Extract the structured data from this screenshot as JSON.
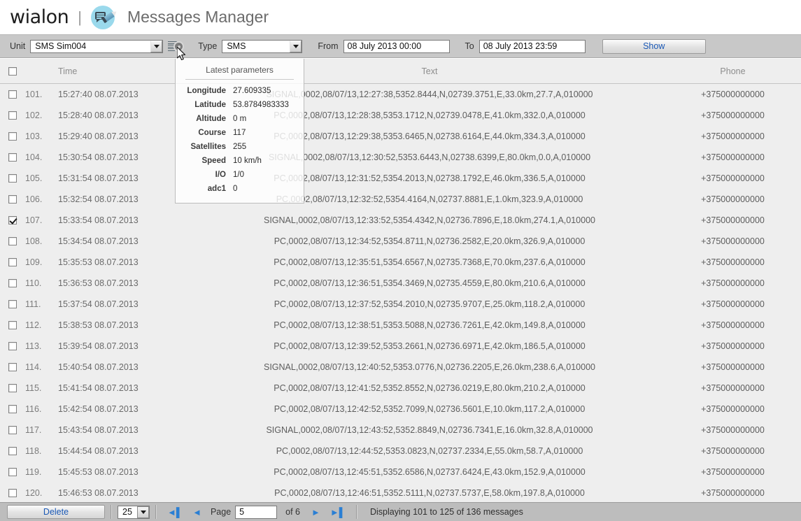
{
  "header": {
    "brand": "wialon",
    "separator": "|",
    "app_icon": "messages-pencil-icon",
    "title": "Messages Manager"
  },
  "toolbar": {
    "unit_label": "Unit",
    "unit_value": "SMS Sim004",
    "settings_icon": "list-gear-icon",
    "type_label": "Type",
    "type_value": "SMS",
    "from_label": "From",
    "from_value": "08 July 2013 00:00",
    "to_label": "To",
    "to_value": "08 July 2013 23:59",
    "show_label": "Show"
  },
  "params_popup": {
    "title": "Latest parameters",
    "rows": [
      {
        "key": "Longitude",
        "value": "27.609335"
      },
      {
        "key": "Latitude",
        "value": "53.8784983333"
      },
      {
        "key": "Altitude",
        "value": "0 m"
      },
      {
        "key": "Course",
        "value": "117"
      },
      {
        "key": "Satellites",
        "value": "255"
      },
      {
        "key": "Speed",
        "value": "10 km/h"
      },
      {
        "key": "I/O",
        "value": "1/0"
      },
      {
        "key": "adc1",
        "value": "0"
      }
    ]
  },
  "table": {
    "columns": [
      "",
      "",
      "Time",
      "Text",
      "Phone"
    ],
    "header": {
      "time": "Time",
      "text": "Text",
      "phone": "Phone"
    },
    "rows": [
      {
        "checked": false,
        "num": "101.",
        "time": "15:27:40  08.07.2013",
        "text": "SIGNAL,0002,08/07/13,12:27:38,5352.8444,N,02739.3751,E,33.0km,27.7,A,010000",
        "phone": "+375000000000"
      },
      {
        "checked": false,
        "num": "102.",
        "time": "15:28:40  08.07.2013",
        "text": "PC,0002,08/07/13,12:28:38,5353.1712,N,02739.0478,E,41.0km,332.0,A,010000",
        "phone": "+375000000000"
      },
      {
        "checked": false,
        "num": "103.",
        "time": "15:29:40  08.07.2013",
        "text": "PC,0002,08/07/13,12:29:38,5353.6465,N,02738.6164,E,44.0km,334.3,A,010000",
        "phone": "+375000000000"
      },
      {
        "checked": false,
        "num": "104.",
        "time": "15:30:54  08.07.2013",
        "text": "SIGNAL,0002,08/07/13,12:30:52,5353.6443,N,02738.6399,E,80.0km,0.0,A,010000",
        "phone": "+375000000000"
      },
      {
        "checked": false,
        "num": "105.",
        "time": "15:31:54  08.07.2013",
        "text": "PC,0002,08/07/13,12:31:52,5354.2013,N,02738.1792,E,46.0km,336.5,A,010000",
        "phone": "+375000000000"
      },
      {
        "checked": false,
        "num": "106.",
        "time": "15:32:54  08.07.2013",
        "text": "PC,0002,08/07/13,12:32:52,5354.4164,N,02737.8881,E,1.0km,323.9,A,010000",
        "phone": "+375000000000"
      },
      {
        "checked": true,
        "num": "107.",
        "time": "15:33:54  08.07.2013",
        "text": "SIGNAL,0002,08/07/13,12:33:52,5354.4342,N,02736.7896,E,18.0km,274.1,A,010000",
        "phone": "+375000000000"
      },
      {
        "checked": false,
        "num": "108.",
        "time": "15:34:54  08.07.2013",
        "text": "PC,0002,08/07/13,12:34:52,5354.8711,N,02736.2582,E,20.0km,326.9,A,010000",
        "phone": "+375000000000"
      },
      {
        "checked": false,
        "num": "109.",
        "time": "15:35:53  08.07.2013",
        "text": "PC,0002,08/07/13,12:35:51,5354.6567,N,02735.7368,E,70.0km,237.6,A,010000",
        "phone": "+375000000000"
      },
      {
        "checked": false,
        "num": "110.",
        "time": "15:36:53  08.07.2013",
        "text": "PC,0002,08/07/13,12:36:51,5354.3469,N,02735.4559,E,80.0km,210.6,A,010000",
        "phone": "+375000000000"
      },
      {
        "checked": false,
        "num": "111.",
        "time": "15:37:54  08.07.2013",
        "text": "PC,0002,08/07/13,12:37:52,5354.2010,N,02735.9707,E,25.0km,118.2,A,010000",
        "phone": "+375000000000"
      },
      {
        "checked": false,
        "num": "112.",
        "time": "15:38:53  08.07.2013",
        "text": "PC,0002,08/07/13,12:38:51,5353.5088,N,02736.7261,E,42.0km,149.8,A,010000",
        "phone": "+375000000000"
      },
      {
        "checked": false,
        "num": "113.",
        "time": "15:39:54  08.07.2013",
        "text": "PC,0002,08/07/13,12:39:52,5353.2661,N,02736.6971,E,42.0km,186.5,A,010000",
        "phone": "+375000000000"
      },
      {
        "checked": false,
        "num": "114.",
        "time": "15:40:54  08.07.2013",
        "text": "SIGNAL,0002,08/07/13,12:40:52,5353.0776,N,02736.2205,E,26.0km,238.6,A,010000",
        "phone": "+375000000000"
      },
      {
        "checked": false,
        "num": "115.",
        "time": "15:41:54  08.07.2013",
        "text": "PC,0002,08/07/13,12:41:52,5352.8552,N,02736.0219,E,80.0km,210.2,A,010000",
        "phone": "+375000000000"
      },
      {
        "checked": false,
        "num": "116.",
        "time": "15:42:54  08.07.2013",
        "text": "PC,0002,08/07/13,12:42:52,5352.7099,N,02736.5601,E,10.0km,117.2,A,010000",
        "phone": "+375000000000"
      },
      {
        "checked": false,
        "num": "117.",
        "time": "15:43:54  08.07.2013",
        "text": "SIGNAL,0002,08/07/13,12:43:52,5352.8849,N,02736.7341,E,16.0km,32.8,A,010000",
        "phone": "+375000000000"
      },
      {
        "checked": false,
        "num": "118.",
        "time": "15:44:54  08.07.2013",
        "text": "PC,0002,08/07/13,12:44:52,5353.0823,N,02737.2334,E,55.0km,58.7,A,010000",
        "phone": "+375000000000"
      },
      {
        "checked": false,
        "num": "119.",
        "time": "15:45:53  08.07.2013",
        "text": "PC,0002,08/07/13,12:45:51,5352.6586,N,02737.6424,E,43.0km,152.9,A,010000",
        "phone": "+375000000000"
      },
      {
        "checked": false,
        "num": "120.",
        "time": "15:46:53  08.07.2013",
        "text": "PC,0002,08/07/13,12:46:51,5352.5111,N,02737.5737,E,58.0km,197.8,A,010000",
        "phone": "+375000000000"
      }
    ]
  },
  "footer": {
    "delete_label": "Delete",
    "page_size": "25",
    "first_icon": "first-page-icon",
    "prev_icon": "prev-page-icon",
    "page_label": "Page",
    "page_value": "5",
    "of_label": "of  6",
    "next_icon": "next-page-icon",
    "last_icon": "last-page-icon",
    "status": "Displaying 101 to 125 of 136 messages"
  },
  "colors": {
    "accent_link": "#1a58b5",
    "nav_arrow": "#2a7fd4",
    "toolbar_bg": "#c8c8c8",
    "table_bg": "#eeeeee",
    "footer_bg": "#bdbdbd",
    "icon_circle": "#9ad9ec"
  }
}
